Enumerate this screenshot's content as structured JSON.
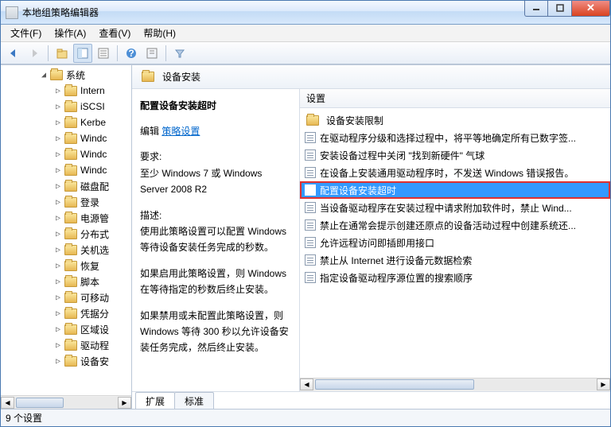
{
  "title": "本地组策略编辑器",
  "menus": {
    "file": "文件(F)",
    "action": "操作(A)",
    "view": "查看(V)",
    "help": "帮助(H)"
  },
  "tree": {
    "root": "系统",
    "items": [
      "Intern",
      "iSCSI",
      "Kerbe",
      "Windc",
      "Windc",
      "Windc",
      "磁盘配",
      "登录",
      "电源管",
      "分布式",
      "关机选",
      "恢复",
      "脚本",
      "可移动",
      "凭据分",
      "区域设",
      "驱动程",
      "设备安"
    ]
  },
  "header_path": "设备安装",
  "desc": {
    "title": "配置设备安装超时",
    "edit_label": "编辑",
    "policy_link": "策略设置",
    "req_label": "要求:",
    "req_text": "至少 Windows 7 或 Windows Server 2008 R2",
    "desc_label": "描述:",
    "p1": "使用此策略设置可以配置 Windows 等待设备安装任务完成的秒数。",
    "p2": "如果启用此策略设置，则 Windows 在等待指定的秒数后终止安装。",
    "p3": "如果禁用或未配置此策略设置，则 Windows 等待 300 秒以允许设备安装任务完成，然后终止安装。"
  },
  "list_header": "设置",
  "settings": [
    {
      "type": "folder",
      "label": "设备安装限制"
    },
    {
      "type": "item",
      "label": "在驱动程序分级和选择过程中，将平等地确定所有已数字签..."
    },
    {
      "type": "item",
      "label": "安装设备过程中关闭 \"找到新硬件\" 气球"
    },
    {
      "type": "item",
      "label": "在设备上安装通用驱动程序时，不发送 Windows 错误报告。"
    },
    {
      "type": "item",
      "label": "配置设备安装超时",
      "selected": true,
      "highlighted": true
    },
    {
      "type": "item",
      "label": "当设备驱动程序在安装过程中请求附加软件时，禁止 Wind..."
    },
    {
      "type": "item",
      "label": "禁止在通常会提示创建还原点的设备活动过程中创建系统还..."
    },
    {
      "type": "item",
      "label": "允许远程访问即插即用接口"
    },
    {
      "type": "item",
      "label": "禁止从 Internet 进行设备元数据检索"
    },
    {
      "type": "item",
      "label": "指定设备驱动程序源位置的搜索顺序"
    }
  ],
  "tabs": {
    "ext": "扩展",
    "std": "标准"
  },
  "status": "9 个设置"
}
